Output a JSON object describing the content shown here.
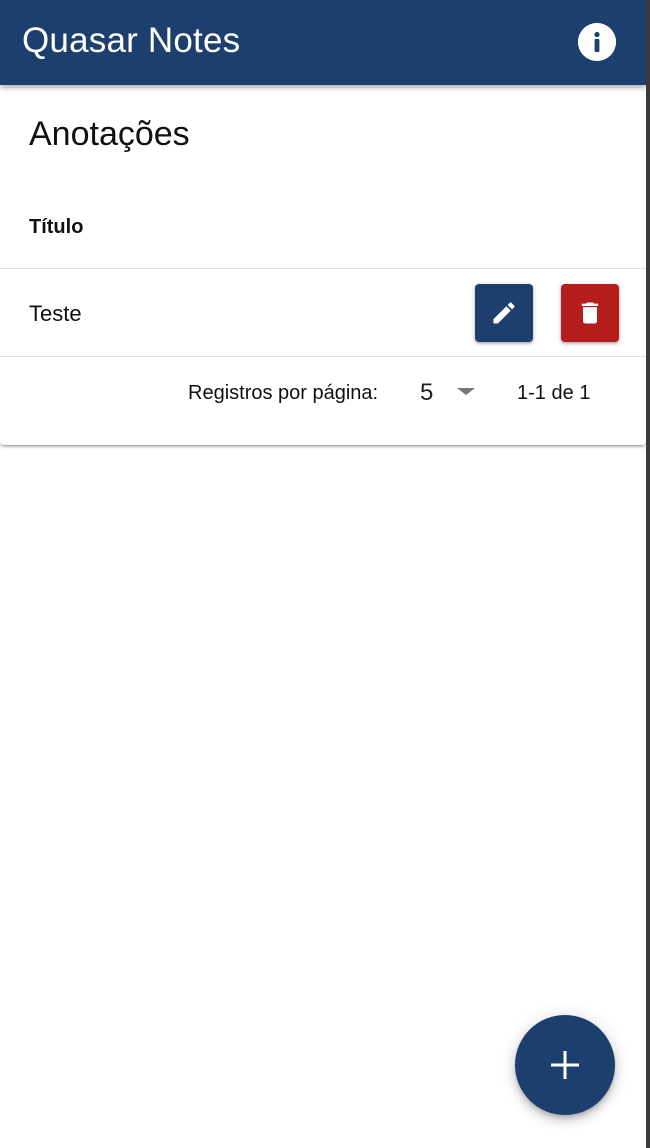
{
  "app": {
    "title": "Quasar Notes",
    "colors": {
      "primary": "#1c3f6e",
      "negative": "#b71c1c",
      "surface": "#ffffff"
    },
    "info_icon": "info-circle-icon"
  },
  "notes_table": {
    "title": "Anotações",
    "columns": [
      "Título"
    ],
    "rows": [
      {
        "title": "Teste",
        "edit_icon": "pencil-icon",
        "delete_icon": "trash-icon"
      }
    ],
    "pagination": {
      "rows_per_page_label": "Registros por página:",
      "rows_per_page_value": "5",
      "range_label": "1-1 de 1",
      "dropdown_icon": "caret-down-icon"
    }
  },
  "fab": {
    "icon": "plus-icon"
  }
}
